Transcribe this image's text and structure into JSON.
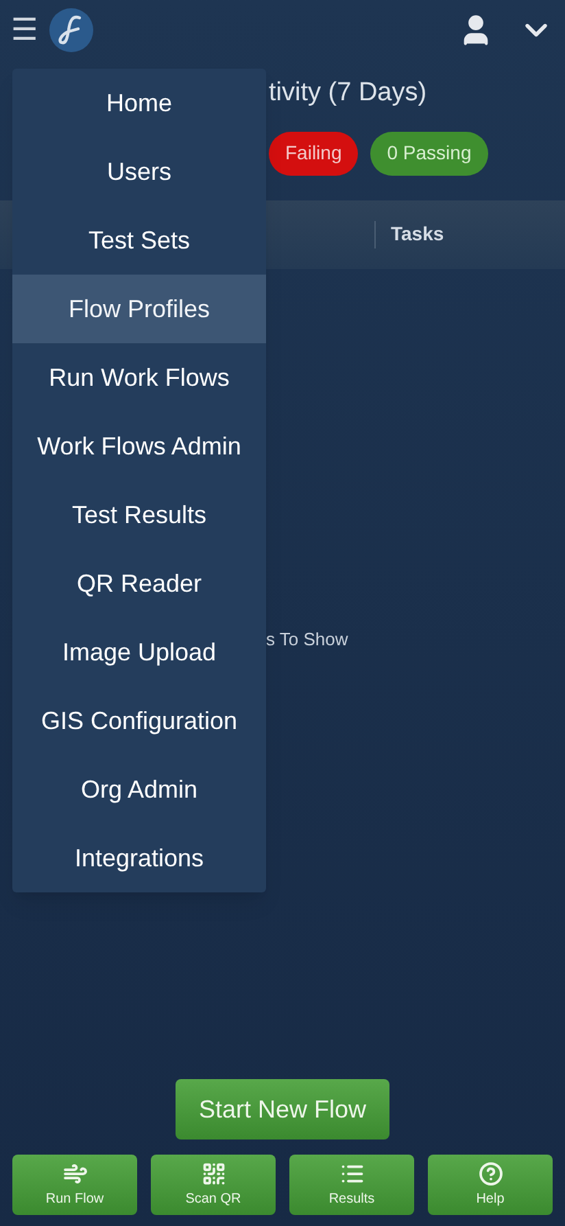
{
  "header": {
    "menu_icon": "☰"
  },
  "menu": [
    {
      "label": "Home",
      "selected": false
    },
    {
      "label": "Users",
      "selected": false
    },
    {
      "label": "Test Sets",
      "selected": false
    },
    {
      "label": "Flow Profiles",
      "selected": true
    },
    {
      "label": "Run Work Flows",
      "selected": false
    },
    {
      "label": "Work Flows Admin",
      "selected": false
    },
    {
      "label": "Test Results",
      "selected": false
    },
    {
      "label": "QR Reader",
      "selected": false
    },
    {
      "label": "Image Upload",
      "selected": false
    },
    {
      "label": "GIS Configuration",
      "selected": false
    },
    {
      "label": "Org Admin",
      "selected": false
    },
    {
      "label": "Integrations",
      "selected": false
    }
  ],
  "activity": {
    "title": "tivity (7 Days)",
    "badges": [
      {
        "kind": "failing",
        "label": "Failing"
      },
      {
        "kind": "passing",
        "label": "0 Passing"
      }
    ]
  },
  "table": {
    "columns": [
      "Tasks"
    ],
    "empty_message": "s To Show"
  },
  "start_button": "Start New Flow",
  "bottom_bar": [
    {
      "kind": "run",
      "label": "Run Flow"
    },
    {
      "kind": "scan",
      "label": "Scan QR"
    },
    {
      "kind": "results",
      "label": "Results"
    },
    {
      "kind": "help",
      "label": "Help"
    }
  ]
}
